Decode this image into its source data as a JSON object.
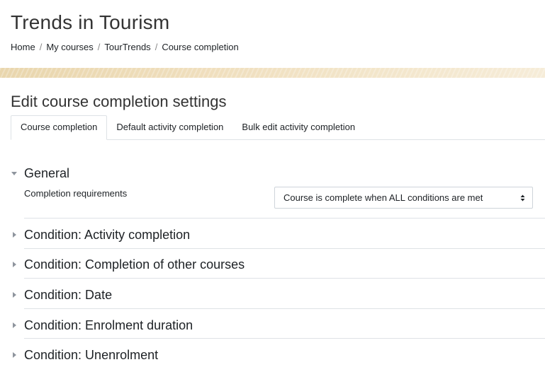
{
  "header": {
    "site_title": "Trends in Tourism",
    "breadcrumb": [
      {
        "label": "Home"
      },
      {
        "label": "My courses"
      },
      {
        "label": "TourTrends"
      },
      {
        "label": "Course completion"
      }
    ],
    "breadcrumb_separator": "/"
  },
  "main": {
    "page_heading": "Edit course completion settings",
    "tabs": [
      {
        "label": "Course completion",
        "active": true
      },
      {
        "label": "Default activity completion",
        "active": false
      },
      {
        "label": "Bulk edit activity completion",
        "active": false
      }
    ],
    "general_section": {
      "title": "General",
      "expanded": true,
      "completion_requirements_label": "Completion requirements",
      "completion_requirements_value": "Course is complete when ALL conditions are met"
    },
    "conditions": [
      {
        "title": "Condition: Activity completion",
        "expanded": false
      },
      {
        "title": "Condition: Completion of other courses",
        "expanded": false
      },
      {
        "title": "Condition: Date",
        "expanded": false
      },
      {
        "title": "Condition: Enrolment duration",
        "expanded": false
      },
      {
        "title": "Condition: Unenrolment",
        "expanded": false
      }
    ]
  },
  "colors": {
    "banner": "#f0dfbe",
    "text": "#1d2125",
    "divider": "#dee2e6",
    "caret": "#8f959e"
  },
  "icons": {
    "expanded_caret": "caret-down-icon",
    "collapsed_caret": "caret-right-icon",
    "select_arrows": "select-arrows-icon"
  }
}
